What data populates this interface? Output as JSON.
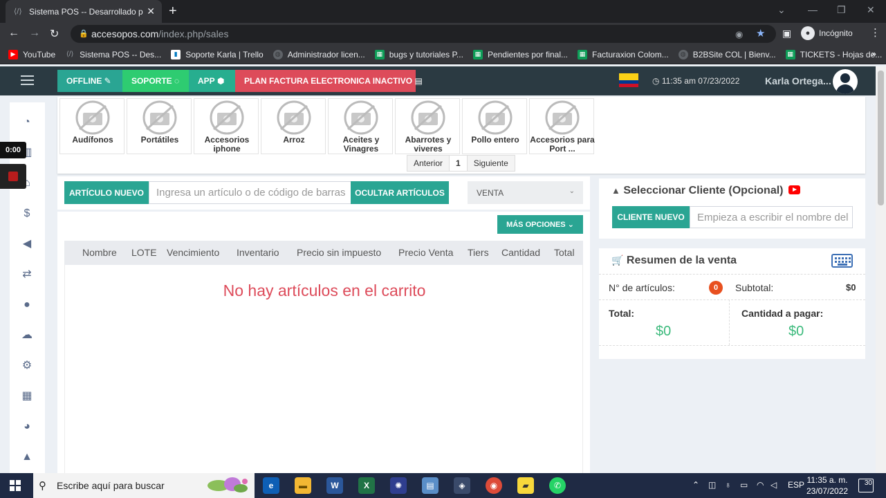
{
  "browser": {
    "tab_title": "Sistema POS -- Desarrollado por",
    "url_host": "accesopos.com",
    "url_path": "/index.php/sales",
    "profile_label": "Incógnito",
    "bookmarks": [
      {
        "label": "YouTube",
        "icon": "youtube-icon"
      },
      {
        "label": "Sistema POS -- Des...",
        "icon": "code-icon"
      },
      {
        "label": "Soporte Karla | Trello",
        "icon": "trello-icon"
      },
      {
        "label": "Administrador licen...",
        "icon": "globe-icon"
      },
      {
        "label": "bugs y tutoriales P...",
        "icon": "sheets-icon"
      },
      {
        "label": "Pendientes por final...",
        "icon": "sheets-icon"
      },
      {
        "label": "Facturaxion Colom...",
        "icon": "sheets-icon"
      },
      {
        "label": "B2BSite COL | Bienv...",
        "icon": "globe-icon"
      },
      {
        "label": "TICKETS - Hojas de...",
        "icon": "sheets-icon"
      }
    ]
  },
  "header": {
    "offline_label": "OFFLINE",
    "soporte_label": "SOPORTE",
    "app_label": "APP",
    "plan_label": "PLAN FACTURA ELECTRONICA INACTIVO",
    "clock": "11:35 am 07/23/2022",
    "user_name": "Karla Ortega...",
    "colors": {
      "offline": "#2aa593",
      "soporte": "#2ecc71",
      "app": "#27ae8f",
      "plan": "#dd4b5a"
    }
  },
  "recorder": {
    "time": "0:00"
  },
  "categories": [
    {
      "label": "Audífonos"
    },
    {
      "label": "Portátiles"
    },
    {
      "label": "Accesorios iphone"
    },
    {
      "label": "Arroz"
    },
    {
      "label": "Aceites y Vinagres"
    },
    {
      "label": "Abarrotes y viveres"
    },
    {
      "label": "Pollo entero"
    },
    {
      "label": "Accesorios para Port ..."
    }
  ],
  "pagination": {
    "prev": "Anterior",
    "current": "1",
    "next": "Siguiente"
  },
  "sale": {
    "new_item_label": "ARTÍCULO NUEVO",
    "search_placeholder": "Ingresa un artículo o de código de barras",
    "hide_items_label": "OCULTAR ARTÍCULOS",
    "mode_selected": "VENTA",
    "more_options_label": "MÁS OPCIONES",
    "columns": [
      "Nombre",
      "LOTE",
      "Vencimiento",
      "Inventario",
      "Precio sin impuesto",
      "Precio Venta",
      "Tiers",
      "Cantidad",
      "Total"
    ],
    "empty_message": "No hay artículos en el carrito"
  },
  "customer": {
    "title": "Seleccionar Cliente (Opcional)",
    "new_customer_label": "CLIENTE NUEVO",
    "search_placeholder": "Empieza a escribir el nombre del"
  },
  "summary": {
    "title": "Resumen de la venta",
    "items_label": "N° de artículos:",
    "items_count": "0",
    "subtotal_label": "Subtotal:",
    "subtotal_value": "$0",
    "total_label": "Total:",
    "total_value": "$0",
    "amount_due_label": "Cantidad a pagar:",
    "amount_due_value": "$0"
  },
  "taskbar": {
    "search_placeholder": "Escribe aquí para buscar",
    "language": "ESP",
    "time": "11:35 a. m.",
    "date": "23/07/2022",
    "notifications": "30"
  }
}
